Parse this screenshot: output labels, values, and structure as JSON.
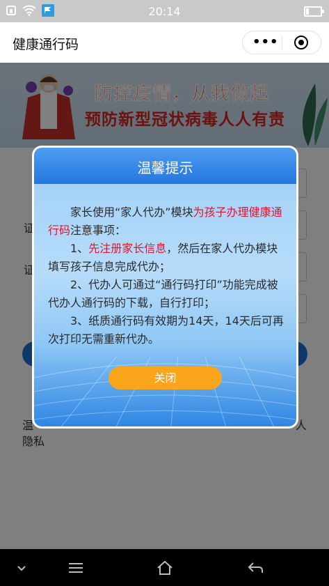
{
  "status_bar": {
    "time": "20:14"
  },
  "nav": {
    "title": "健康通行码"
  },
  "banner": {
    "line1": "防控疫情，从我做起",
    "line2": "预防新型冠状病毒人人有责"
  },
  "background": {
    "label_frag_1": "证",
    "label_frag_2": "证",
    "footer_frag_1": "温",
    "footer_frag_2": "人",
    "footer_frag_3": "隐私"
  },
  "modal": {
    "title": "温馨提示",
    "p1_a": "家长使用“家人代办”模块",
    "p1_b": "为孩子办理健康通行码",
    "p1_c": "注意事项：",
    "p2_a": "1、",
    "p2_b": "先注册家长信息",
    "p2_c": "，然后在家人代办模块填写孩子信息完成代办；",
    "p3": "2、代办人可通过“通行码打印”功能完成被代办人通行码的下载，自行打印；",
    "p4": "3、纸质通行码有效期为14天，14天后可再次打印无需重新代办。",
    "close_label": "关闭"
  },
  "colors": {
    "accent": "#2276de",
    "highlight": "#e4142b",
    "button": "#fba51d"
  },
  "icons": [
    "sim-icon",
    "wifi-icon",
    "app-flag-icon",
    "battery-icon",
    "more-dots-icon",
    "target-icon",
    "chevron-down-icon",
    "menu-icon",
    "home-icon",
    "back-icon"
  ]
}
